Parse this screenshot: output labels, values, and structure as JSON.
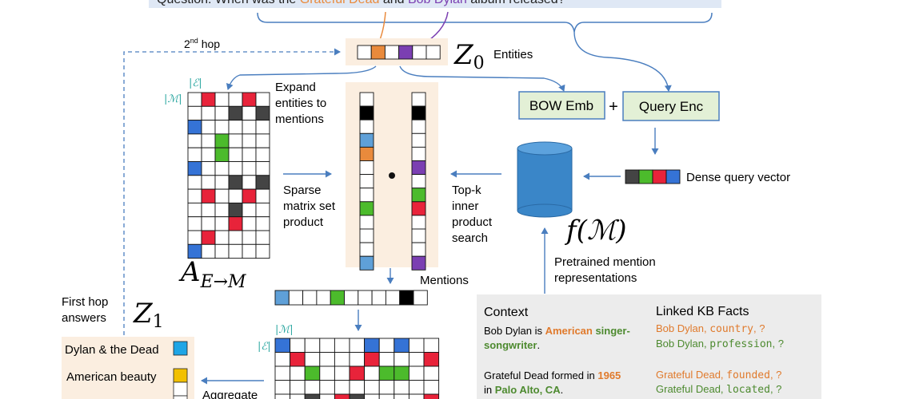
{
  "question": {
    "prefix": "Question: When was the ",
    "entity1": "Grateful Dead",
    "middle": " and ",
    "entity2": "Bob Dylan",
    "suffix": " album released?"
  },
  "labels": {
    "second_hop_main": "2",
    "second_hop_sup": "nd",
    "second_hop_rest": " hop",
    "z0_letter": "Z",
    "z0_sub": "0",
    "entities": "Entities",
    "expand_l1": "Expand",
    "expand_l2": "entities to",
    "expand_l3": "mentions",
    "sparse_l1": "Sparse",
    "sparse_l2": "matrix set",
    "sparse_l3": "product",
    "topk_l1": "Top-k",
    "topk_l2": "inner",
    "topk_l3": "product",
    "topk_l4": "search",
    "bow_emb": "BOW Emb",
    "plus": "+",
    "query_enc": "Query Enc",
    "dense_query": "Dense query vector",
    "f_m": "f(ℳ)",
    "pretrained_l1": "Pretrained mention",
    "pretrained_l2": "representations",
    "a_letter": "A",
    "a_sub": "E→M",
    "mentions": "Mentions",
    "first_hop_l1": "First hop",
    "first_hop_l2": "answers",
    "z1_letter": "Z",
    "z1_sub": "1",
    "aggregate": "Aggregate",
    "set_e": "|ℰ|",
    "set_m": "|ℳ|"
  },
  "answers": [
    {
      "label": "Dylan & the Dead",
      "color": "#1ea5e6"
    },
    {
      "label": "American beauty",
      "color": "#f2c000"
    }
  ],
  "context_panel": {
    "context_header": "Context",
    "facts_header": "Linked KB Facts",
    "line1_a": "Bob Dylan is ",
    "line1_b": "American",
    "line1_c": " singer-",
    "line1_d": "songwriter",
    "line1_e": ".",
    "line2_a": "Grateful Dead formed in ",
    "line2_b": "1965",
    "line2_c": "in ",
    "line2_d": "Palo Alto, CA",
    "line2_e": ".",
    "fact1_e": "Bob Dylan, ",
    "fact1_r": "country",
    "fact1_q": ", ?",
    "fact2_e": "Bob Dylan, ",
    "fact2_r": "profession",
    "fact2_q": ", ?",
    "fact3_e": "Grateful Dead, ",
    "fact3_r": "founded",
    "fact3_q": ", ?",
    "fact4_e": "Grateful Dead, ",
    "fact4_r": "located",
    "fact4_q": ", ?"
  },
  "colors": {
    "orange": "#e98a3c",
    "purple": "#7b3fb2",
    "red": "#e8233a",
    "blue": "#3573d6",
    "green": "#4cbb2c",
    "dark": "#444444",
    "black": "#000000",
    "arrow": "#4a7ebf",
    "accent_green": "#4d8a2f",
    "teal": "#2aa6a0"
  }
}
